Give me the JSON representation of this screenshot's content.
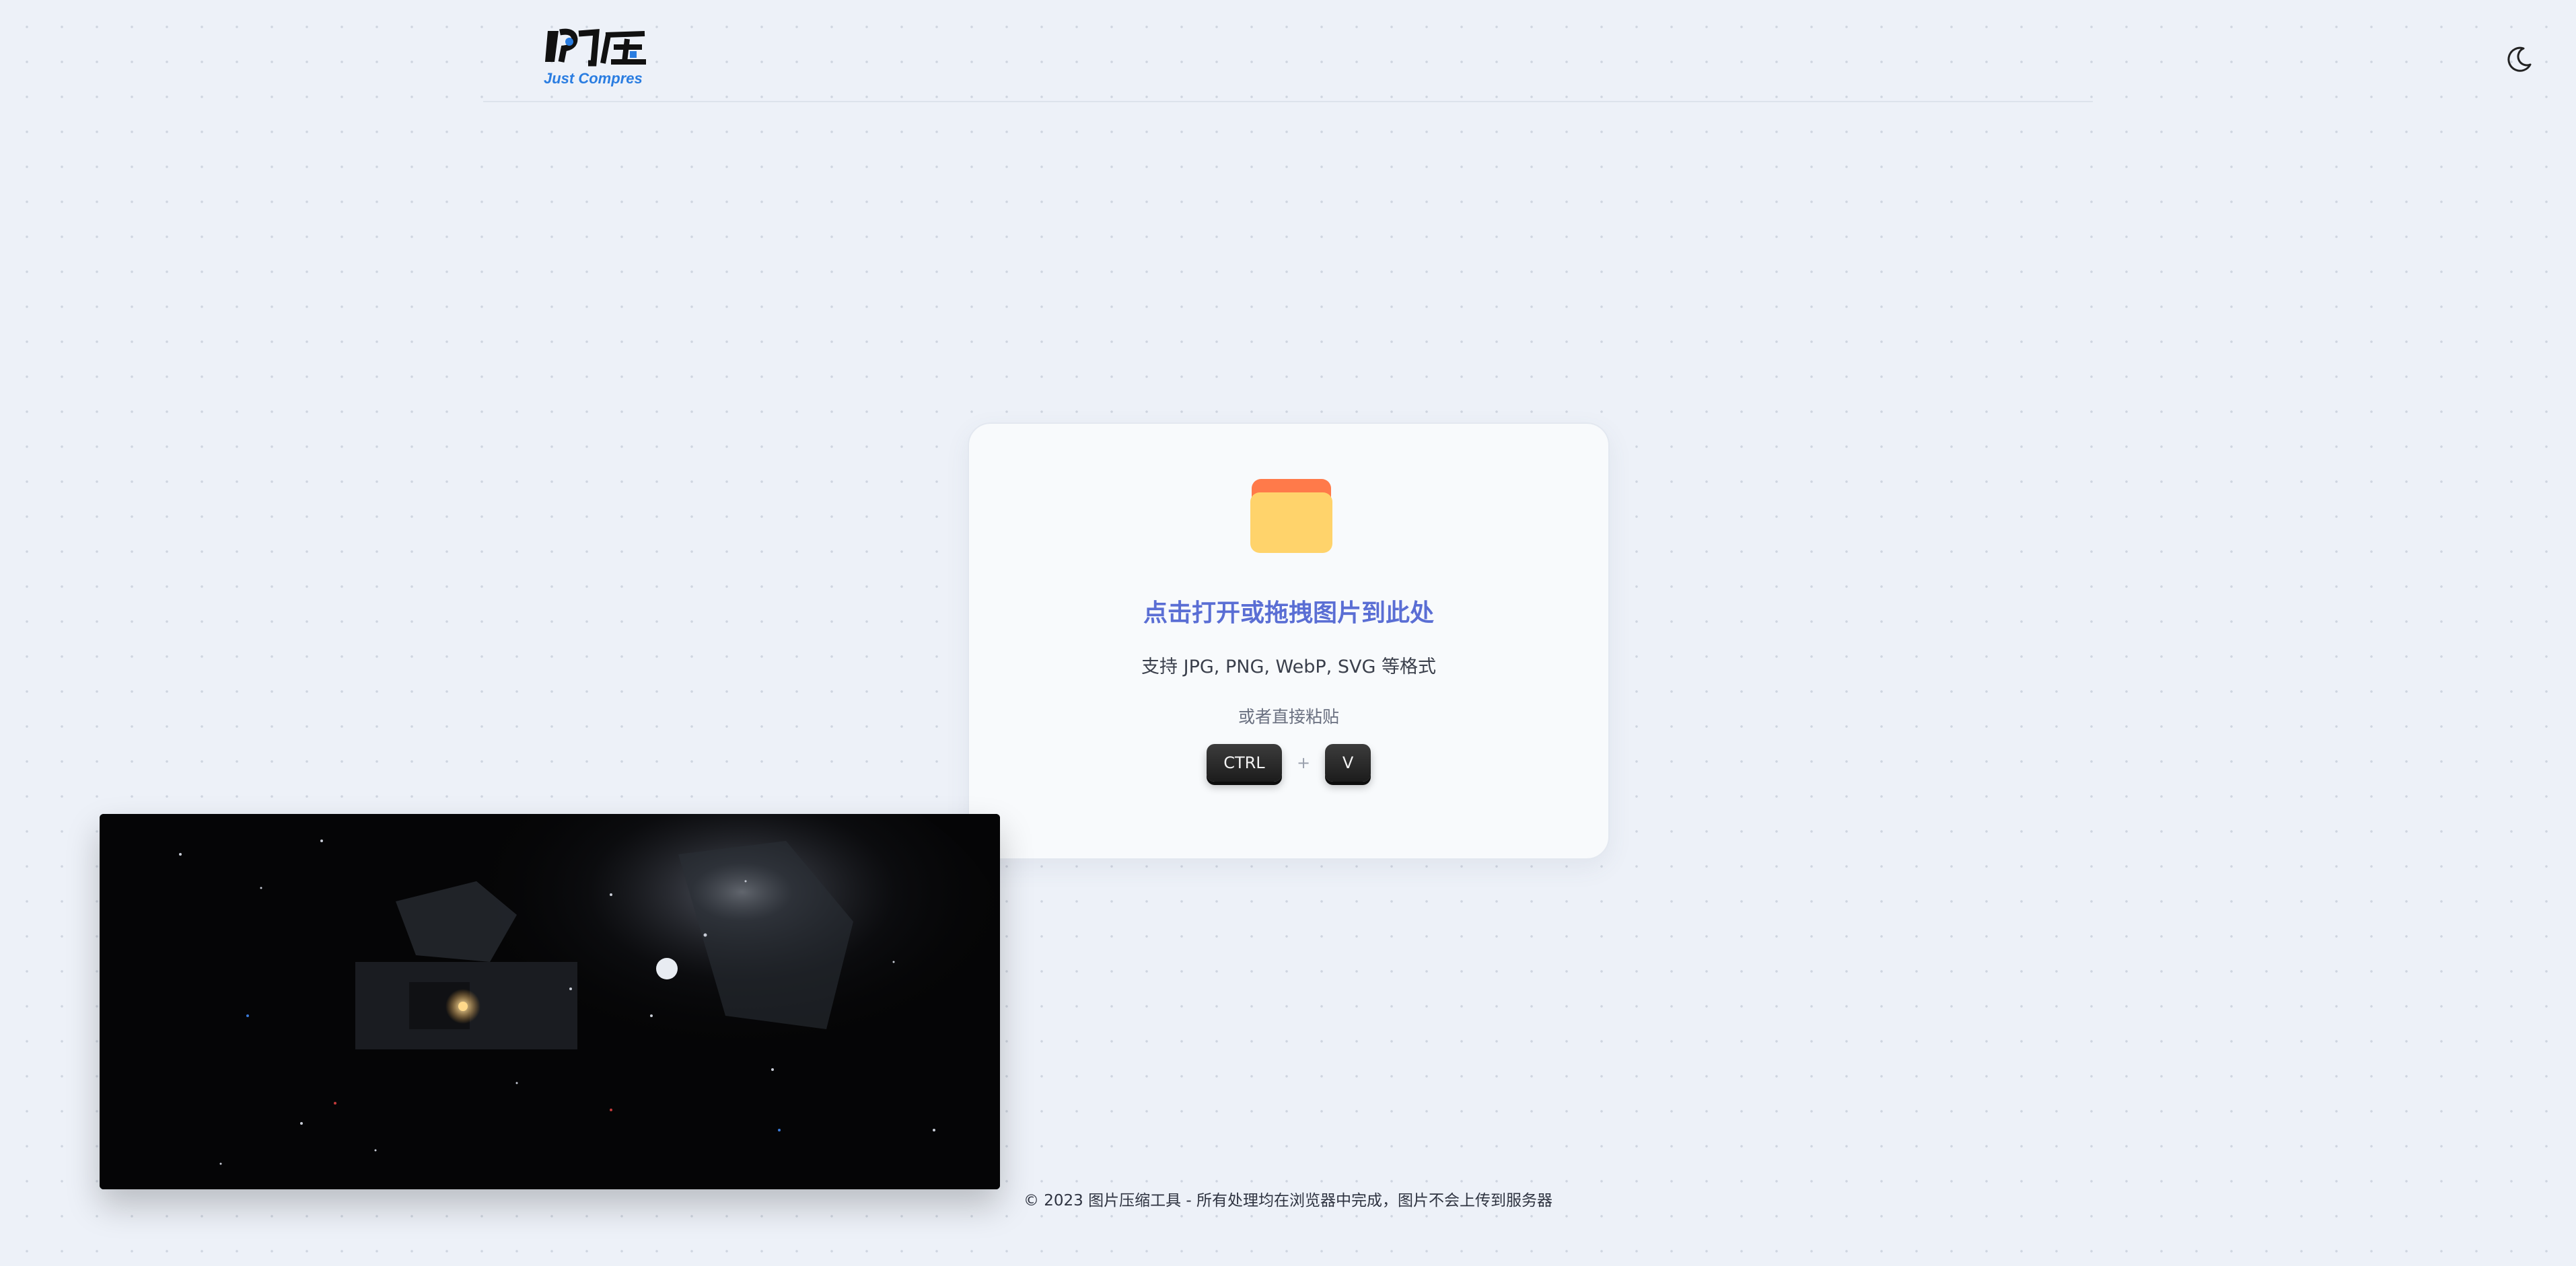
{
  "header": {
    "logo": {
      "text": "即压",
      "subtitle": "Just Compres"
    },
    "theme_toggle_icon": "moon-icon"
  },
  "upload_card": {
    "icon": "folder-icon",
    "title": "点击打开或拖拽图片到此处",
    "formats": "支持 JPG, PNG, WebP, SVG 等格式",
    "paste_hint": "或者直接粘贴",
    "shortcut": {
      "key1": "CTRL",
      "plus": "+",
      "key2": "V"
    }
  },
  "preview_image": {
    "description_icon": "space-scene-thumbnail"
  },
  "footer": {
    "text": "© 2023 图片压缩工具 - 所有处理均在浏览器中完成，图片不会上传到服务器"
  },
  "colors": {
    "accent": "#5a6ed4",
    "logo_blue": "#2a7de1",
    "background": "#edf1f8",
    "folder_tab": "#ff7a4a",
    "folder_body": "#ffd36b"
  }
}
